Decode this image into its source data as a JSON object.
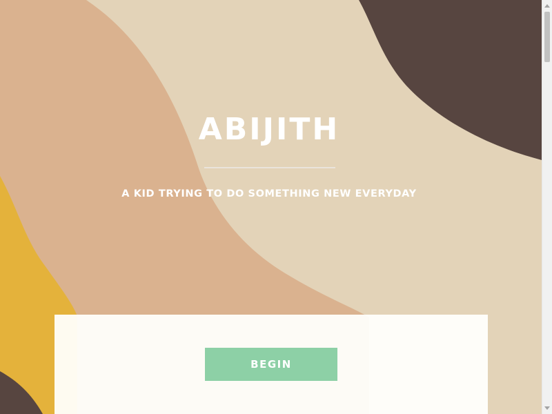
{
  "hero": {
    "title": "ABIJITH",
    "subtitle": "A KID TRYING TO DO SOMETHING NEW EVERYDAY"
  },
  "cta": {
    "begin_label": "BEGIN"
  },
  "colors": {
    "dark_brown": "#574540",
    "cream": "#e3d3b8",
    "tan": "#dab28f",
    "mustard": "#e4b23b",
    "button_green": "#8dd0a6",
    "panel_white": "#fefdfb"
  }
}
